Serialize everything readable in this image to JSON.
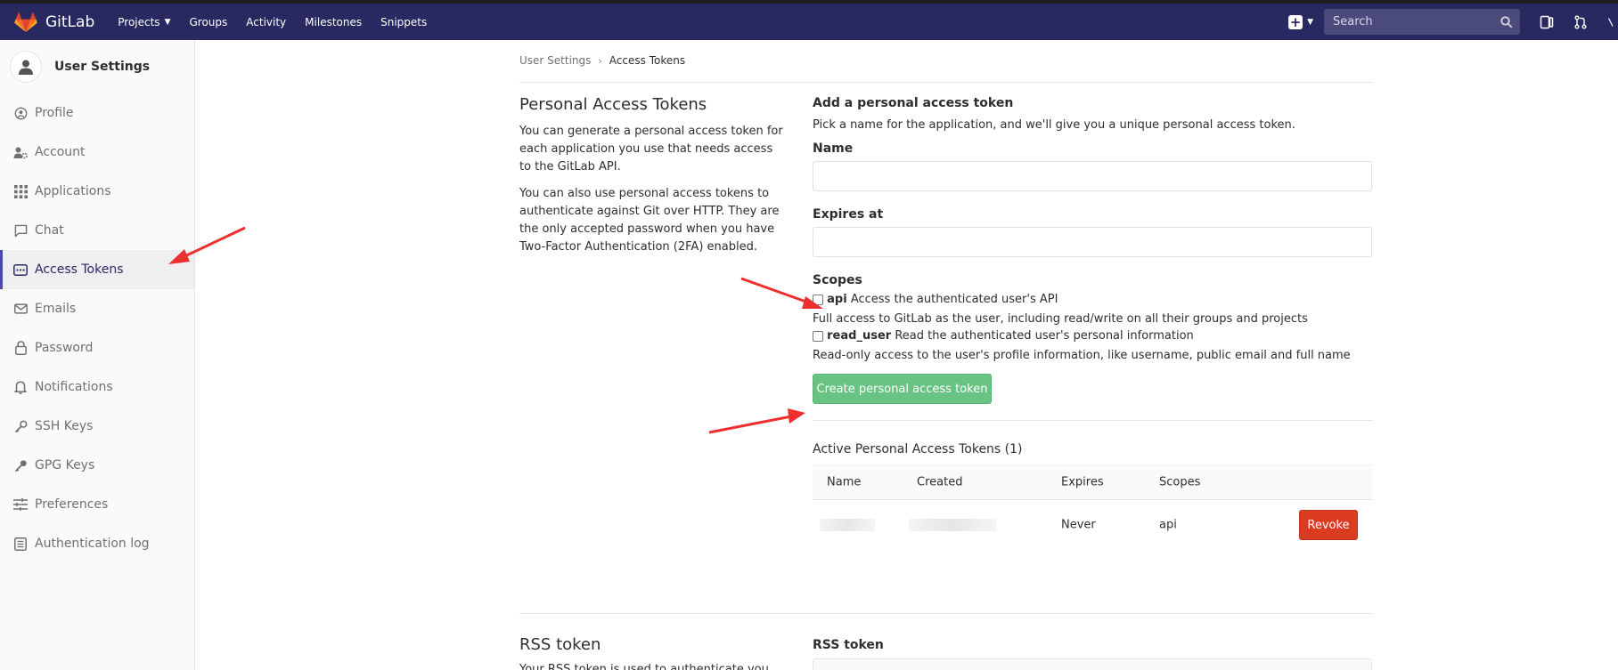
{
  "navbar": {
    "brand": "GitLab",
    "links": [
      {
        "label": "Projects",
        "caret": true
      },
      {
        "label": "Groups"
      },
      {
        "label": "Activity"
      },
      {
        "label": "Milestones"
      },
      {
        "label": "Snippets"
      }
    ],
    "search_placeholder": "Search"
  },
  "sidebar": {
    "title": "User Settings",
    "items": [
      {
        "label": "Profile",
        "icon": "profile-icon"
      },
      {
        "label": "Account",
        "icon": "account-icon"
      },
      {
        "label": "Applications",
        "icon": "applications-icon"
      },
      {
        "label": "Chat",
        "icon": "chat-icon"
      },
      {
        "label": "Access Tokens",
        "icon": "access-tokens-icon",
        "active": true
      },
      {
        "label": "Emails",
        "icon": "email-icon"
      },
      {
        "label": "Password",
        "icon": "lock-icon"
      },
      {
        "label": "Notifications",
        "icon": "bell-icon"
      },
      {
        "label": "SSH Keys",
        "icon": "key-icon"
      },
      {
        "label": "GPG Keys",
        "icon": "key-icon"
      },
      {
        "label": "Preferences",
        "icon": "sliders-icon"
      },
      {
        "label": "Authentication log",
        "icon": "log-icon"
      }
    ]
  },
  "breadcrumb": {
    "root": "User Settings",
    "current": "Access Tokens"
  },
  "intro": {
    "title": "Personal Access Tokens",
    "p1": "You can generate a personal access token for each application you use that needs access to the GitLab API.",
    "p2": "You can also use personal access tokens to authenticate against Git over HTTP. They are the only accepted password when you have Two-Factor Authentication (2FA) enabled."
  },
  "form": {
    "heading": "Add a personal access token",
    "description": "Pick a name for the application, and we'll give you a unique personal access token.",
    "name_label": "Name",
    "name_value": "",
    "expires_label": "Expires at",
    "expires_value": "",
    "scopes_label": "Scopes",
    "scopes": [
      {
        "name": "api",
        "summary": "Access the authenticated user's API",
        "detail": "Full access to GitLab as the user, including read/write on all their groups and projects",
        "checked": false
      },
      {
        "name": "read_user",
        "summary": "Read the authenticated user's personal information",
        "detail": "Read-only access to the user's profile information, like username, public email and full name",
        "checked": false
      }
    ],
    "submit_label": "Create personal access token"
  },
  "active_tokens": {
    "heading": "Active Personal Access Tokens (1)",
    "columns": [
      "Name",
      "Created",
      "Expires",
      "Scopes"
    ],
    "rows": [
      {
        "name": "",
        "created": "",
        "expires": "Never",
        "scopes": "api",
        "action": "Revoke"
      }
    ]
  },
  "rss": {
    "title": "RSS token",
    "label": "RSS token",
    "desc_fragment": "Your RSS token is used to authenticate you"
  },
  "colors": {
    "navbar": "#292961",
    "accent": "#4b4ba3",
    "create_button": "#69c383",
    "revoke_button": "#db3b21",
    "annotation_arrow": "#ee2f2f"
  }
}
